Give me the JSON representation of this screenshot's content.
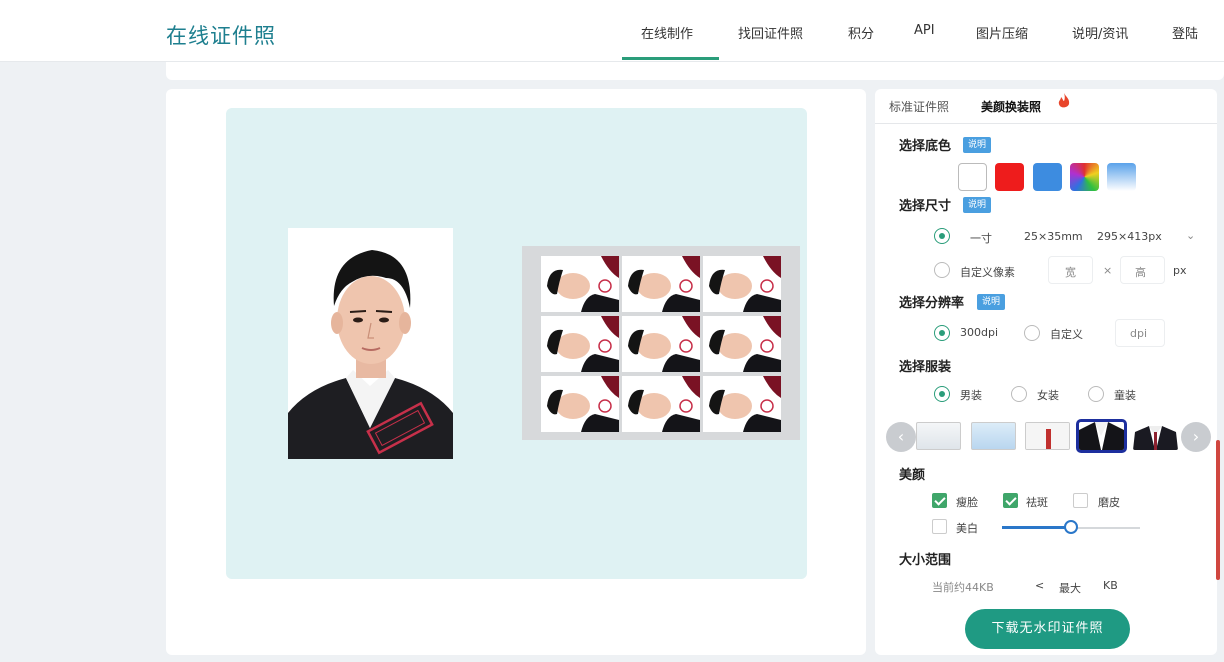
{
  "header": {
    "brand": "在线证件照",
    "nav": [
      "在线制作",
      "找回证件照",
      "积分",
      "API",
      "图片压缩",
      "说明/资讯",
      "登陆"
    ],
    "active_index": 0
  },
  "tabs": {
    "standard": "标准证件照",
    "beauty": "美颜换装照"
  },
  "background_color": {
    "title": "选择底色",
    "badge": "说明",
    "swatches": [
      "white",
      "red",
      "blue",
      "rainbow",
      "gradient-blue"
    ]
  },
  "size": {
    "title": "选择尺寸",
    "badge": "说明",
    "preset_label": "一寸",
    "preset_mm": "25×35mm",
    "preset_px": "295×413px",
    "custom_label": "自定义像素",
    "width_placeholder": "宽",
    "times": "×",
    "height_placeholder": "高",
    "unit": "px"
  },
  "resolution": {
    "title": "选择分辨率",
    "badge": "说明",
    "preset_label": "300dpi",
    "custom_label": "自定义",
    "dpi_placeholder": "dpi"
  },
  "clothes": {
    "title": "选择服装",
    "options": [
      "男装",
      "女装",
      "童装"
    ],
    "selected": 0,
    "selected_style": 3
  },
  "beauty": {
    "title": "美颜",
    "options": [
      {
        "label": "瘦脸",
        "checked": true
      },
      {
        "label": "祛斑",
        "checked": true
      },
      {
        "label": "磨皮",
        "checked": false
      },
      {
        "label": "美白",
        "checked": false
      }
    ],
    "slider_level": 0.5
  },
  "file_size": {
    "title": "大小范围",
    "current": "当前约44KB",
    "lt": "<",
    "max_placeholder": "最大",
    "unit": "KB"
  },
  "download_label": "下载无水印证件照",
  "photo": {
    "stamp_text": "样片水印"
  }
}
